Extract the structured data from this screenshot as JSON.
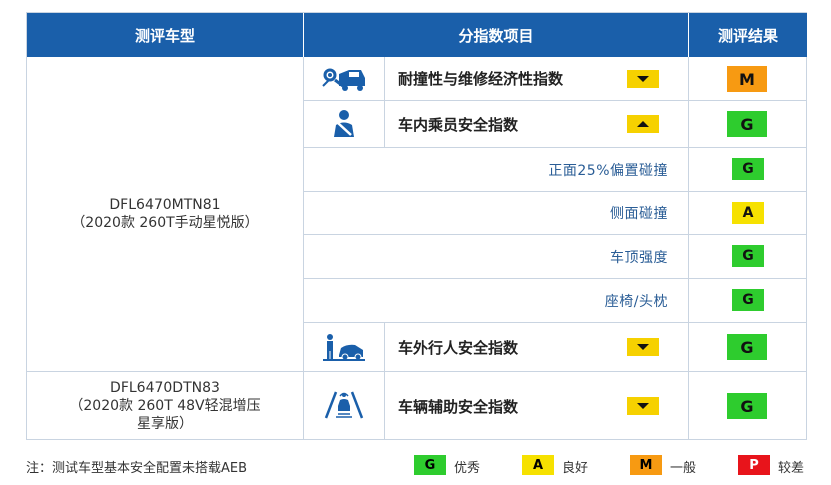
{
  "header": {
    "col_model": "测评车型",
    "col_item": "分指数项目",
    "col_result": "测评结果"
  },
  "models": [
    {
      "code": "DFL6470MTN81",
      "desc": "（2020款 260T手动星悦版）"
    },
    {
      "code": "DFL6470DTN83",
      "desc": "（2020款 260T 48V轻混增压",
      "desc2": "星享版）"
    }
  ],
  "rows": [
    {
      "label": "耐撞性与维修经济性指数",
      "icon": "car-repair-icon",
      "arrow": "down",
      "result": "M"
    },
    {
      "label": "车内乘员安全指数",
      "icon": "seated-occupant-icon",
      "arrow": "up",
      "result": "G"
    },
    {
      "label": "正面25%偏置碰撞",
      "result": "G"
    },
    {
      "label": "侧面碰撞",
      "result": "A"
    },
    {
      "label": "车顶强度",
      "result": "G"
    },
    {
      "label": "座椅/头枕",
      "result": "G"
    },
    {
      "label": "车外行人安全指数",
      "icon": "pedestrian-car-icon",
      "arrow": "down",
      "result": "G"
    },
    {
      "label": "车辆辅助安全指数",
      "icon": "lane-assist-icon",
      "arrow": "down",
      "result": "G"
    }
  ],
  "footer": {
    "note": "注：测试车型基本安全配置未搭载AEB",
    "legend": [
      {
        "badge": "G",
        "label": "优秀",
        "color": "#2ecc2e"
      },
      {
        "badge": "A",
        "label": "良好",
        "color": "#f6e100"
      },
      {
        "badge": "M",
        "label": "一般",
        "color": "#f79a12"
      },
      {
        "badge": "P",
        "label": "较差",
        "color": "#e8141b"
      }
    ]
  },
  "colors": {
    "header_blue": "#1a5faa",
    "green": "#2ecc2e",
    "yellow": "#f6e100",
    "orange": "#f79a12",
    "red": "#e8141b"
  }
}
